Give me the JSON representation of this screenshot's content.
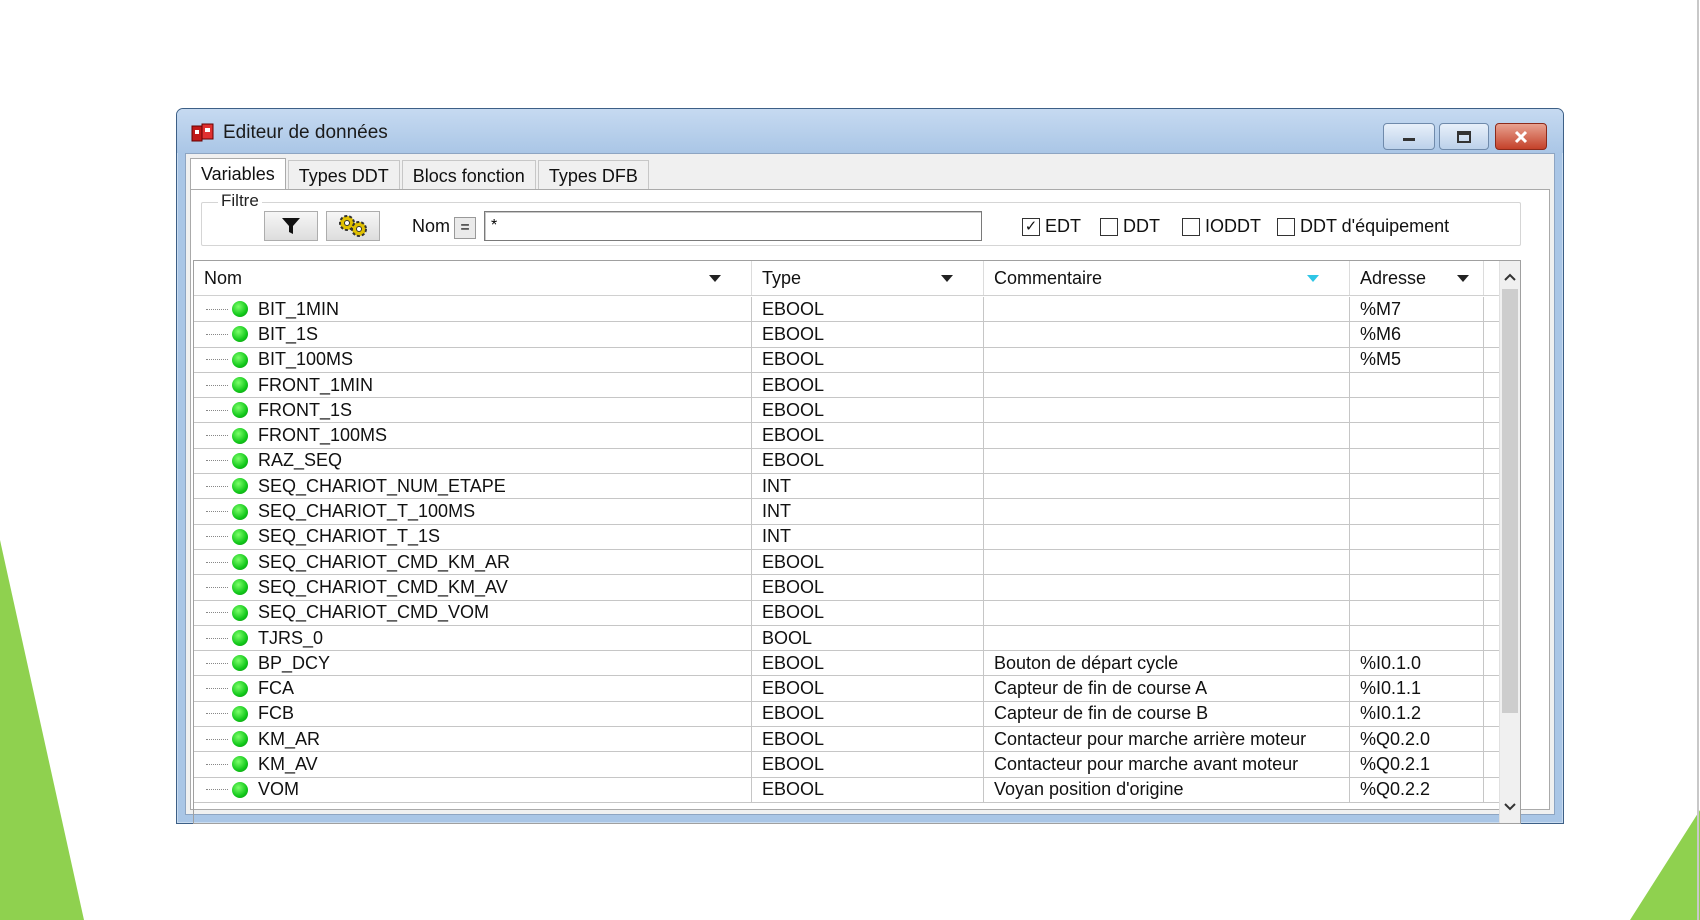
{
  "window": {
    "title": "Editeur de données"
  },
  "tabs": [
    {
      "label": "Variables",
      "active": true
    },
    {
      "label": "Types DDT",
      "active": false
    },
    {
      "label": "Blocs fonction",
      "active": false
    },
    {
      "label": "Types DFB",
      "active": false
    }
  ],
  "filter": {
    "legend": "Filtre",
    "filter_icon": "funnel-icon",
    "settings_icon": "gears-icon",
    "name_label": "Nom",
    "equals_label": "=",
    "name_value": "*",
    "checkboxes": [
      {
        "label": "EDT",
        "checked": true
      },
      {
        "label": "DDT",
        "checked": false
      },
      {
        "label": "IODDT",
        "checked": false
      },
      {
        "label": "DDT d'équipement",
        "checked": false
      }
    ]
  },
  "table": {
    "columns": [
      "Nom",
      "Type",
      "Commentaire",
      "Adresse"
    ],
    "rows": [
      {
        "nom": "BIT_1MIN",
        "type": "EBOOL",
        "commentaire": "",
        "adresse": "%M7"
      },
      {
        "nom": "BIT_1S",
        "type": "EBOOL",
        "commentaire": "",
        "adresse": "%M6"
      },
      {
        "nom": "BIT_100MS",
        "type": "EBOOL",
        "commentaire": "",
        "adresse": "%M5"
      },
      {
        "nom": "FRONT_1MIN",
        "type": "EBOOL",
        "commentaire": "",
        "adresse": ""
      },
      {
        "nom": "FRONT_1S",
        "type": "EBOOL",
        "commentaire": "",
        "adresse": ""
      },
      {
        "nom": "FRONT_100MS",
        "type": "EBOOL",
        "commentaire": "",
        "adresse": ""
      },
      {
        "nom": "RAZ_SEQ",
        "type": "EBOOL",
        "commentaire": "",
        "adresse": ""
      },
      {
        "nom": "SEQ_CHARIOT_NUM_ETAPE",
        "type": "INT",
        "commentaire": "",
        "adresse": ""
      },
      {
        "nom": "SEQ_CHARIOT_T_100MS",
        "type": "INT",
        "commentaire": "",
        "adresse": ""
      },
      {
        "nom": "SEQ_CHARIOT_T_1S",
        "type": "INT",
        "commentaire": "",
        "adresse": ""
      },
      {
        "nom": "SEQ_CHARIOT_CMD_KM_AR",
        "type": "EBOOL",
        "commentaire": "",
        "adresse": ""
      },
      {
        "nom": "SEQ_CHARIOT_CMD_KM_AV",
        "type": "EBOOL",
        "commentaire": "",
        "adresse": ""
      },
      {
        "nom": "SEQ_CHARIOT_CMD_VOM",
        "type": "EBOOL",
        "commentaire": "",
        "adresse": ""
      },
      {
        "nom": "TJRS_0",
        "type": "BOOL",
        "commentaire": "",
        "adresse": ""
      },
      {
        "nom": "BP_DCY",
        "type": "EBOOL",
        "commentaire": "Bouton de départ cycle",
        "adresse": "%I0.1.0"
      },
      {
        "nom": "FCA",
        "type": "EBOOL",
        "commentaire": "Capteur de fin de course A",
        "adresse": "%I0.1.1"
      },
      {
        "nom": "FCB",
        "type": "EBOOL",
        "commentaire": "Capteur de fin de course B",
        "adresse": "%I0.1.2"
      },
      {
        "nom": "KM_AR",
        "type": "EBOOL",
        "commentaire": "Contacteur pour marche arrière moteur",
        "adresse": "%Q0.2.0"
      },
      {
        "nom": "KM_AV",
        "type": "EBOOL",
        "commentaire": "Contacteur pour marche avant moteur",
        "adresse": "%Q0.2.1"
      },
      {
        "nom": "VOM",
        "type": "EBOOL",
        "commentaire": "Voyan position d'origine",
        "adresse": "%Q0.2.2"
      }
    ]
  },
  "colors": {
    "accent_green": "#8fd14f",
    "status_dot": "#12c81a",
    "titlebar": "#aac6e6",
    "sort_cyan": "#2fc6e6"
  }
}
